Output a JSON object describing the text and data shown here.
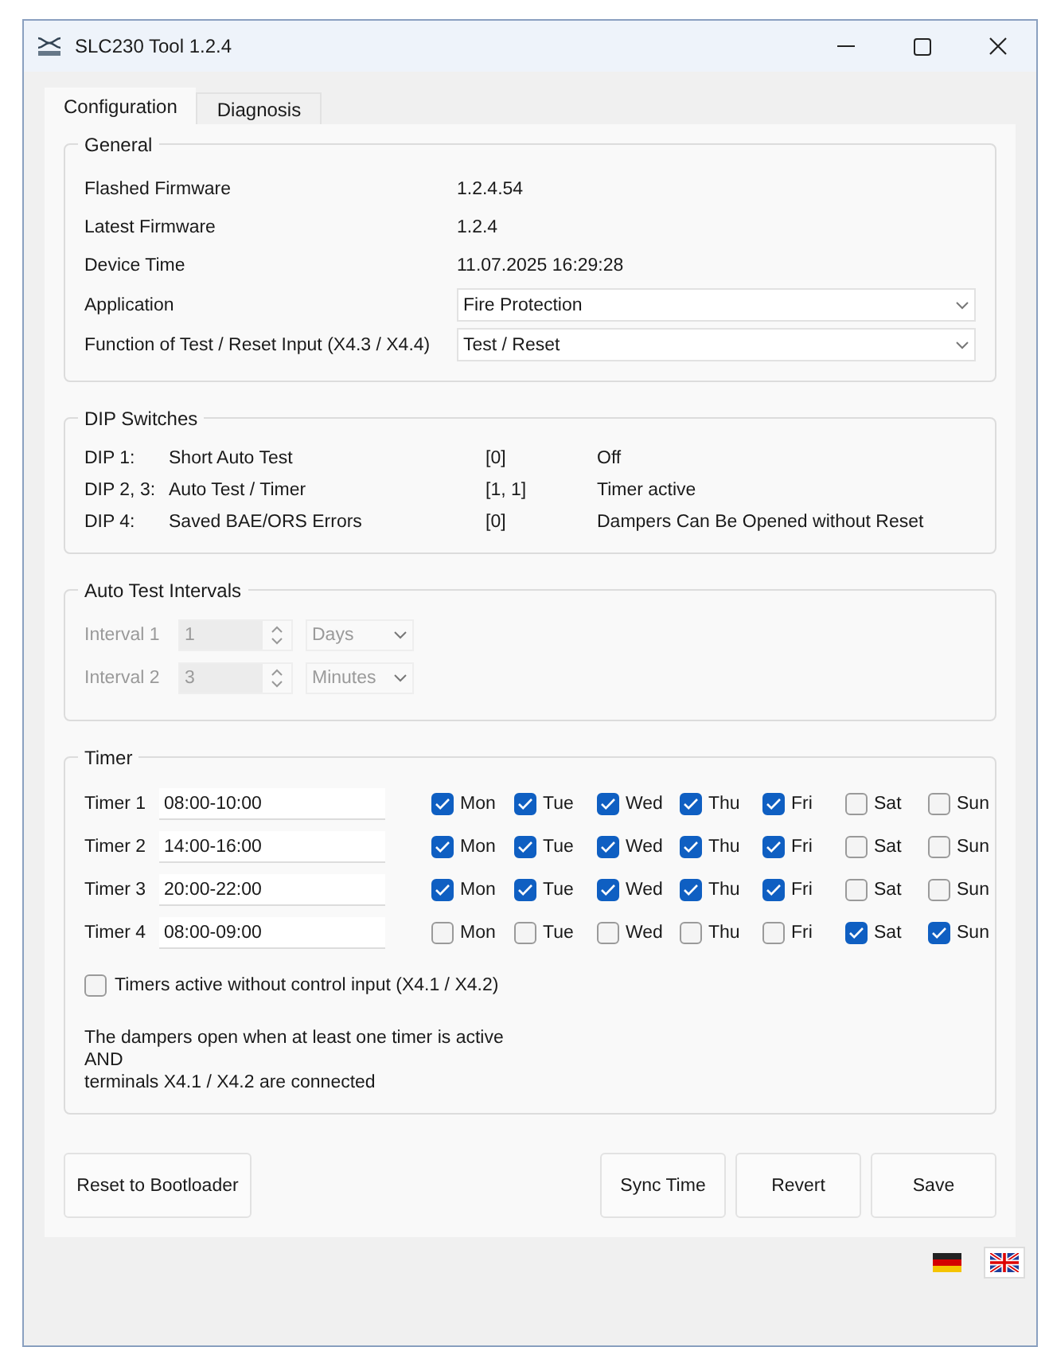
{
  "window": {
    "title": "SLC230 Tool 1.2.4"
  },
  "tabs": [
    {
      "label": "Configuration",
      "selected": true
    },
    {
      "label": "Diagnosis",
      "selected": false
    }
  ],
  "general": {
    "title": "General",
    "rows": [
      {
        "kind": "text",
        "label": "Flashed Firmware",
        "value": "1.2.4.54"
      },
      {
        "kind": "text",
        "label": "Latest Firmware",
        "value": "1.2.4"
      },
      {
        "kind": "text",
        "label": "Device Time",
        "value": "11.07.2025 16:29:28"
      },
      {
        "kind": "select",
        "label": "Application",
        "value": "Fire Protection"
      },
      {
        "kind": "select",
        "label": "Function of Test / Reset Input (X4.3 / X4.4)",
        "value": "Test / Reset"
      }
    ]
  },
  "dip_switches": {
    "title": "DIP Switches",
    "rows": [
      {
        "dip": "DIP 1:",
        "name": "Short Auto Test",
        "setting": "[0]",
        "meaning": "Off"
      },
      {
        "dip": "DIP 2, 3:",
        "name": "Auto Test / Timer",
        "setting": "[1, 1]",
        "meaning": "Timer active"
      },
      {
        "dip": "DIP 4:",
        "name": "Saved BAE/ORS Errors",
        "setting": "[0]",
        "meaning": "Dampers Can Be Opened without Reset"
      }
    ]
  },
  "auto_test_intervals": {
    "title": "Auto Test Intervals",
    "disabled": true,
    "rows": [
      {
        "label": "Interval 1",
        "value": "1",
        "unit": "Days"
      },
      {
        "label": "Interval 2",
        "value": "3",
        "unit": "Minutes"
      }
    ]
  },
  "timer": {
    "title": "Timer",
    "timers": [
      {
        "label": "Timer 1",
        "value": "08:00-10:00",
        "days": [
          {
            "label": "Mon",
            "checked": true
          },
          {
            "label": "Tue",
            "checked": true
          },
          {
            "label": "Wed",
            "checked": true
          },
          {
            "label": "Thu",
            "checked": true
          },
          {
            "label": "Fri",
            "checked": true
          },
          {
            "label": "Sat",
            "checked": false
          },
          {
            "label": "Sun",
            "checked": false
          }
        ]
      },
      {
        "label": "Timer 2",
        "value": "14:00-16:00",
        "days": [
          {
            "label": "Mon",
            "checked": true
          },
          {
            "label": "Tue",
            "checked": true
          },
          {
            "label": "Wed",
            "checked": true
          },
          {
            "label": "Thu",
            "checked": true
          },
          {
            "label": "Fri",
            "checked": true
          },
          {
            "label": "Sat",
            "checked": false
          },
          {
            "label": "Sun",
            "checked": false
          }
        ]
      },
      {
        "label": "Timer 3",
        "value": "20:00-22:00",
        "days": [
          {
            "label": "Mon",
            "checked": true
          },
          {
            "label": "Tue",
            "checked": true
          },
          {
            "label": "Wed",
            "checked": true
          },
          {
            "label": "Thu",
            "checked": true
          },
          {
            "label": "Fri",
            "checked": true
          },
          {
            "label": "Sat",
            "checked": false
          },
          {
            "label": "Sun",
            "checked": false
          }
        ]
      },
      {
        "label": "Timer 4",
        "value": "08:00-09:00",
        "days": [
          {
            "label": "Mon",
            "checked": false
          },
          {
            "label": "Tue",
            "checked": false
          },
          {
            "label": "Wed",
            "checked": false
          },
          {
            "label": "Thu",
            "checked": false
          },
          {
            "label": "Fri",
            "checked": false
          },
          {
            "label": "Sat",
            "checked": true
          },
          {
            "label": "Sun",
            "checked": true
          }
        ]
      }
    ],
    "without_control_input": {
      "label": "Timers active without control input (X4.1 / X4.2)",
      "checked": false
    },
    "note": [
      "The dampers open when at least one timer is active",
      "AND",
      "terminals X4.1 / X4.2 are connected"
    ]
  },
  "buttons": {
    "left": [
      "Reset to Bootloader"
    ],
    "right": [
      "Sync Time",
      "Revert",
      "Save"
    ]
  },
  "languages": [
    {
      "kind": "german",
      "selected": false
    },
    {
      "kind": "english",
      "selected": true
    }
  ]
}
